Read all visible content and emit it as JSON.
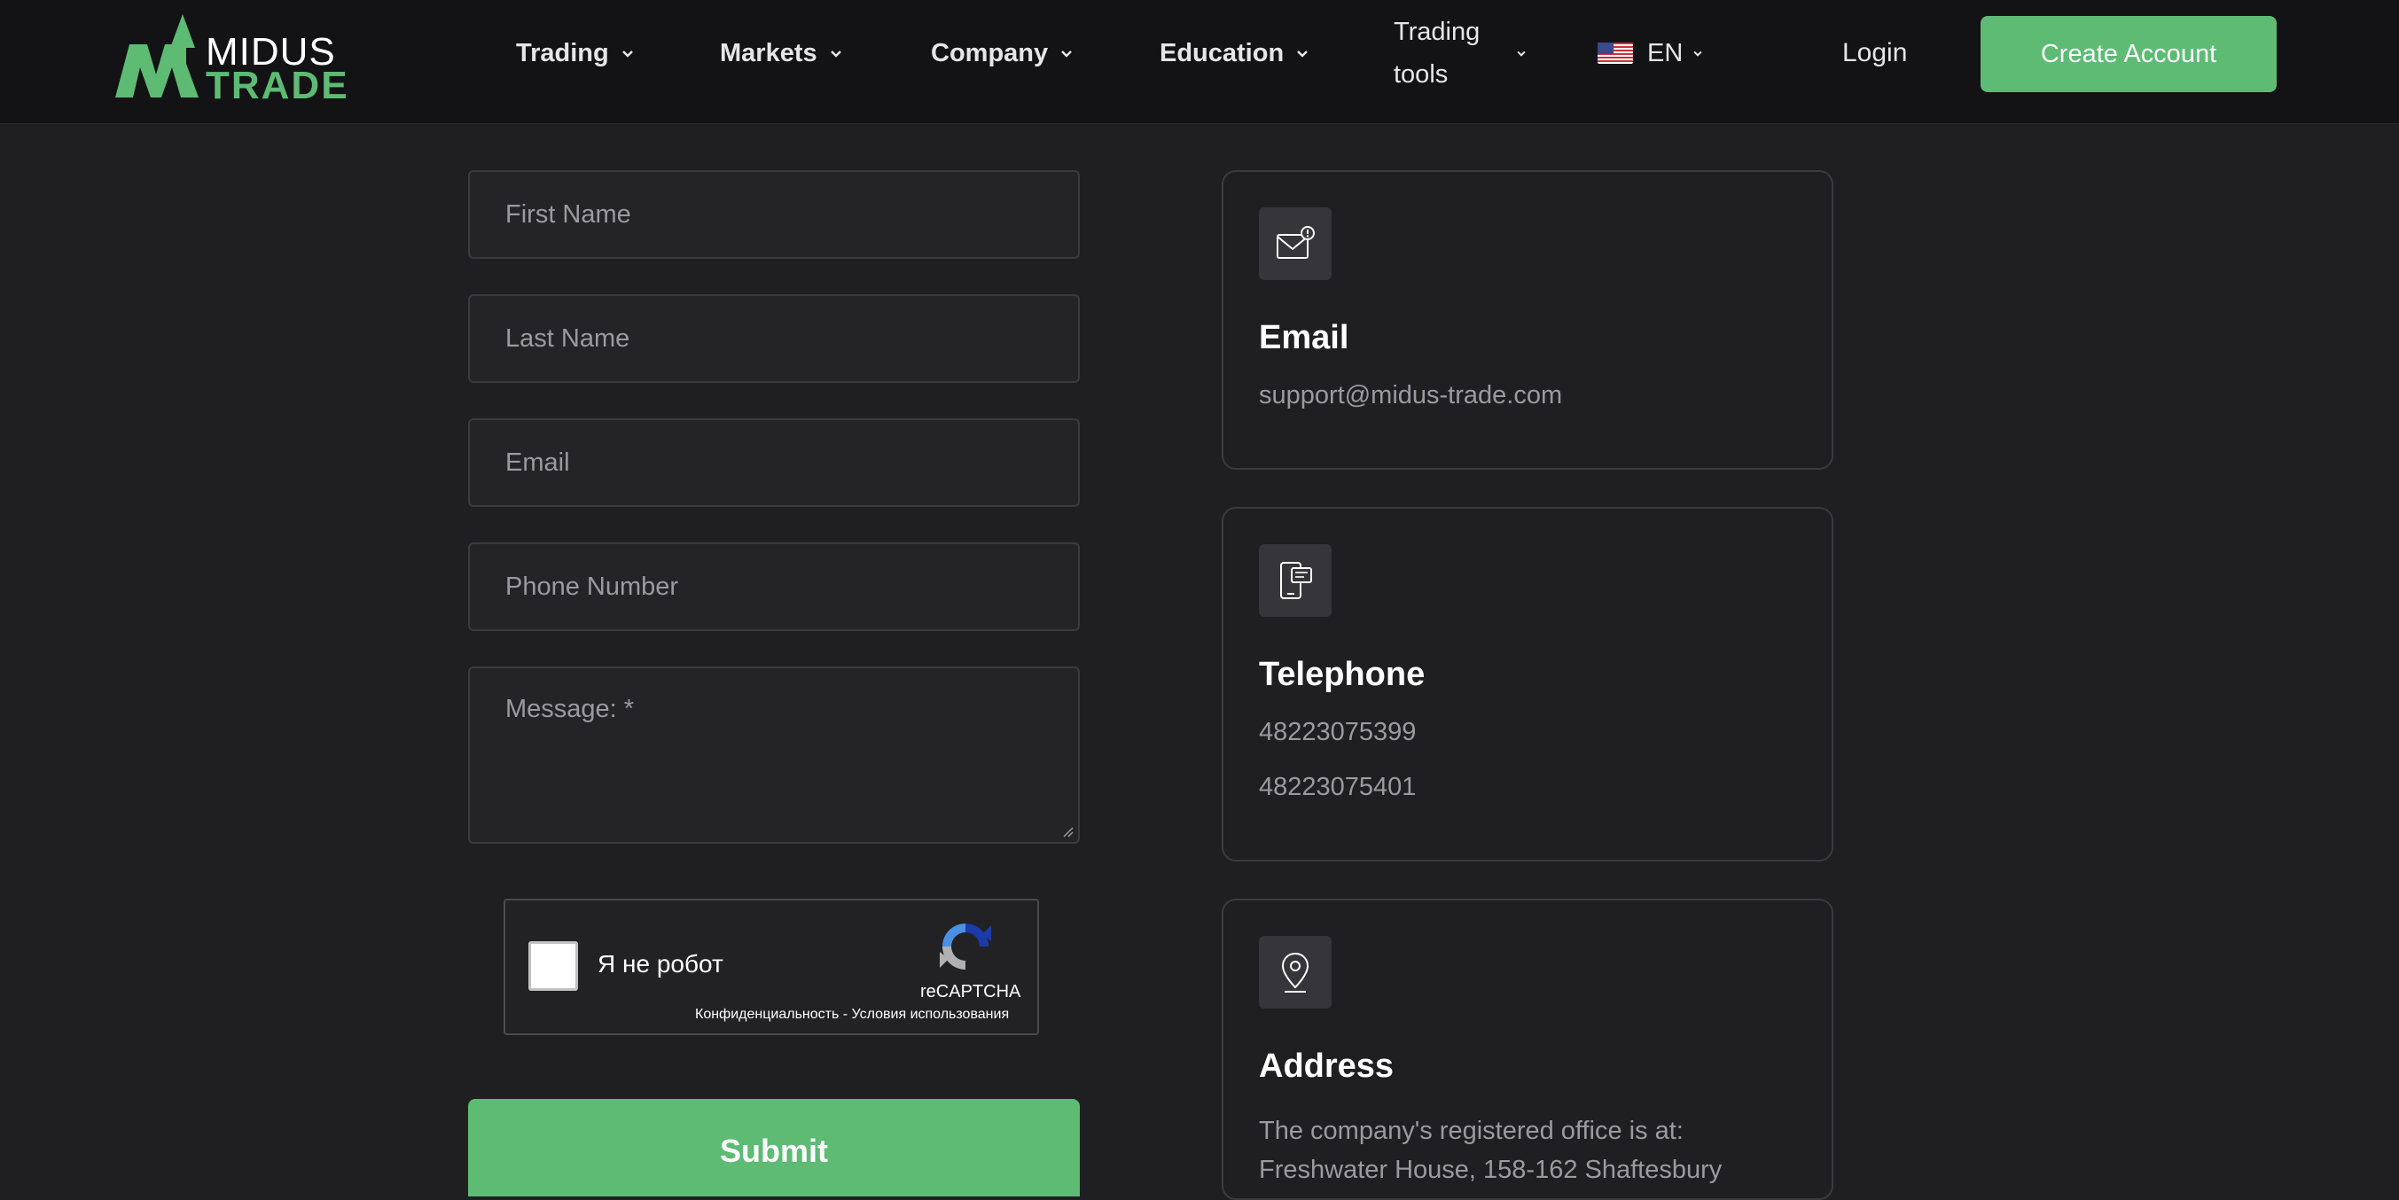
{
  "brand": {
    "line1": "MIDUS",
    "line2": "TRADE",
    "accent": "#5dbb74"
  },
  "nav": {
    "items": [
      {
        "label": "Trading"
      },
      {
        "label": "Markets"
      },
      {
        "label": "Company"
      },
      {
        "label": "Education"
      }
    ],
    "tools_line1": "Trading",
    "tools_line2": "tools",
    "language": "EN",
    "login": "Login",
    "cta": "Create Account"
  },
  "form": {
    "first_name_placeholder": "First Name",
    "last_name_placeholder": "Last Name",
    "email_placeholder": "Email",
    "phone_placeholder": "Phone Number",
    "message_placeholder": "Message: *",
    "captcha_label": "Я не робот",
    "captcha_brand": "reCAPTCHA",
    "captcha_terms": "Конфиденциальность - Условия использования",
    "submit": "Submit"
  },
  "contacts": {
    "email": {
      "title": "Email",
      "value": "support@midus-trade.com",
      "icon": "envelope-icon"
    },
    "telephone": {
      "title": "Telephone",
      "phone1": "48223075399",
      "phone2": "48223075401",
      "icon": "phone-chat-icon"
    },
    "address": {
      "title": "Address",
      "text": "The company's registered office is at: Freshwater House, 158-162 Shaftesbury",
      "icon": "map-pin-icon"
    }
  }
}
